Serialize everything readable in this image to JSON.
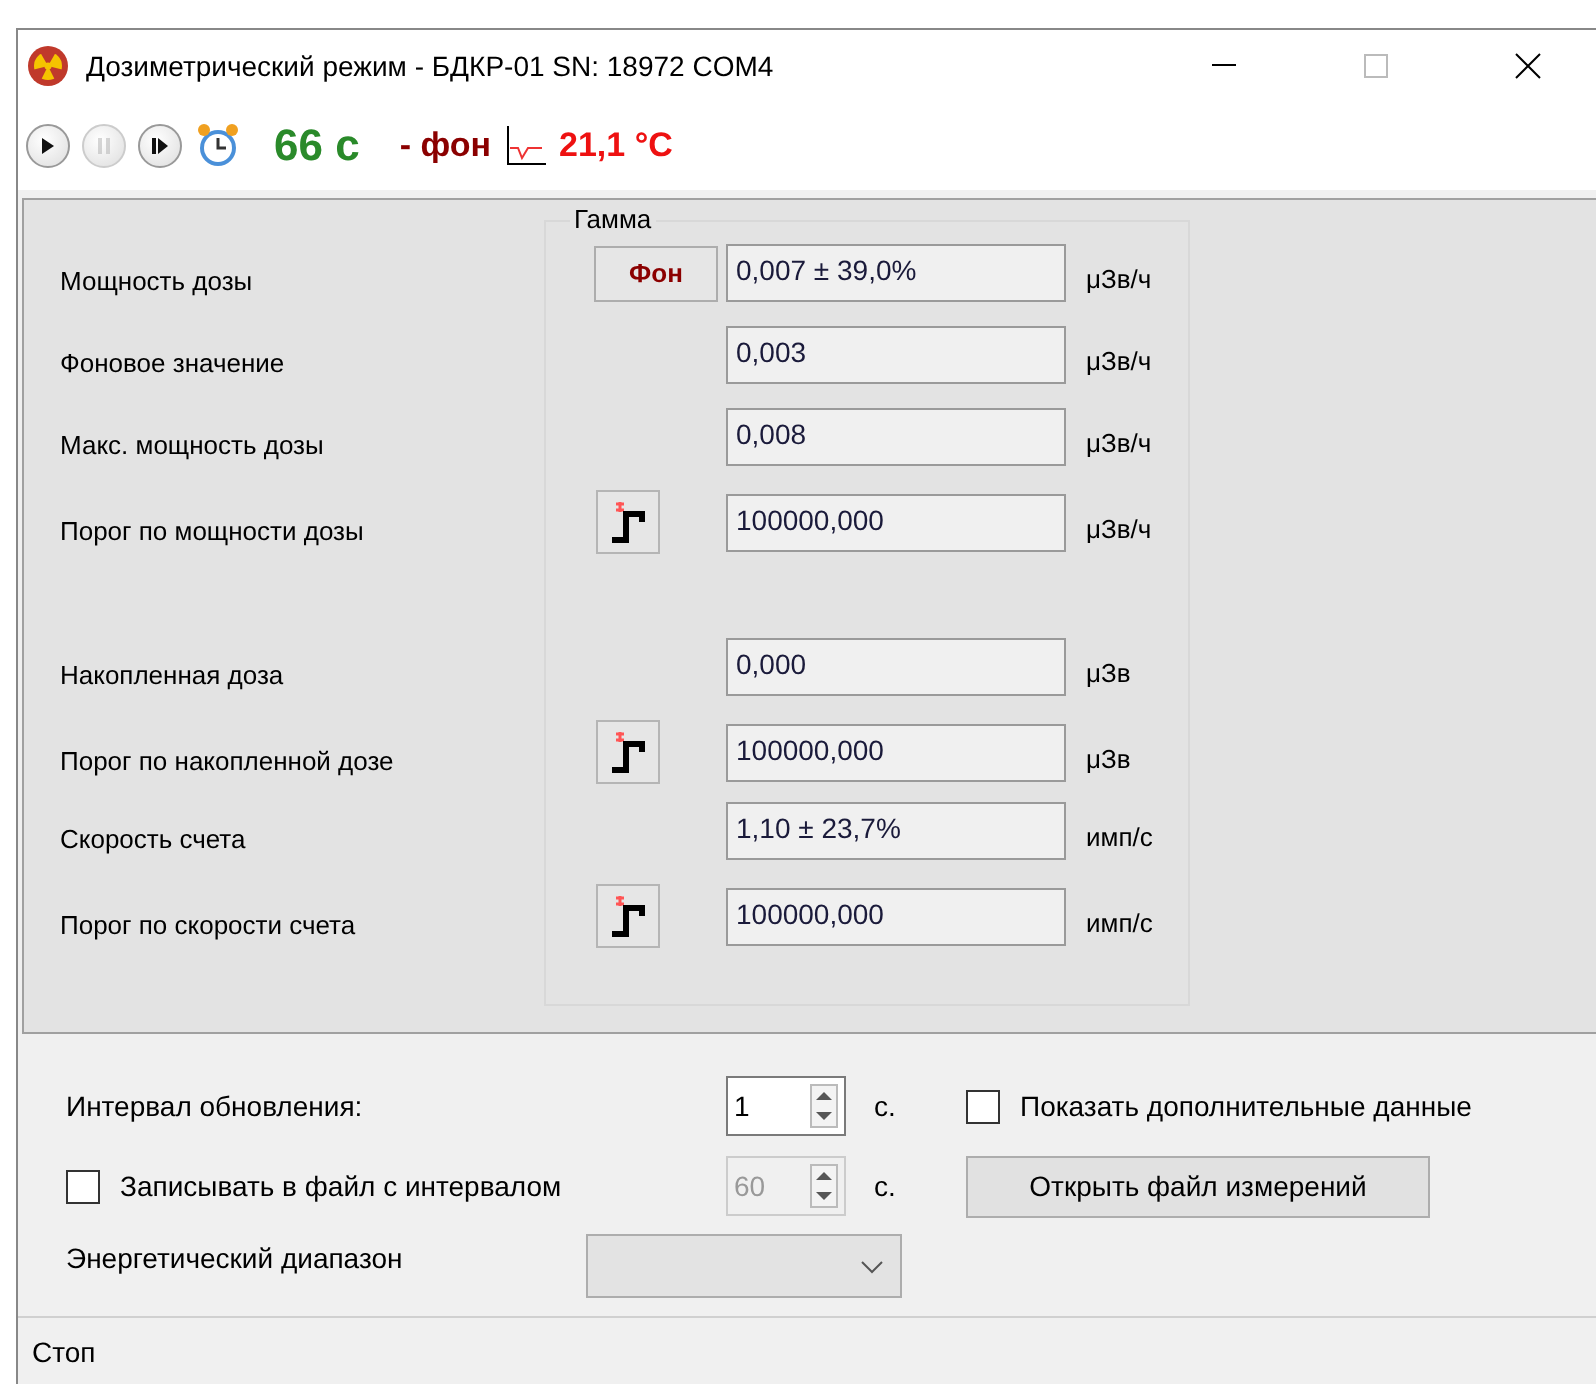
{
  "window": {
    "title": "Дозиметрический режим - БДКР-01 SN: 18972 COM4"
  },
  "toolbar": {
    "buttons": [
      {
        "kind": "play",
        "disabled": false
      },
      {
        "kind": "pause",
        "disabled": true
      },
      {
        "kind": "step",
        "disabled": false
      }
    ],
    "timer": "66 с",
    "mode": "- фон",
    "temperature": "21,1 °C"
  },
  "group": {
    "title": "Гамма",
    "sections": [
      [
        {
          "label": "Мощность дозы",
          "button": {
            "kind": "text",
            "label": "Фон"
          },
          "value": "0,007 ± 39,0%",
          "unit": "μЗв/ч"
        },
        {
          "label": "Фоновое значение",
          "value": "0,003",
          "unit": "μЗв/ч"
        },
        {
          "label": "Макс. мощность дозы",
          "value": "0,008",
          "unit": "μЗв/ч"
        },
        {
          "label": "Порог по мощности дозы",
          "button": {
            "kind": "threshold"
          },
          "value": "100000,000",
          "unit": "μЗв/ч"
        }
      ],
      [
        {
          "label": "Накопленная доза",
          "value": "0,000",
          "unit": "μЗв"
        },
        {
          "label": "Порог по накопленной дозе",
          "button": {
            "kind": "threshold"
          },
          "value": "100000,000",
          "unit": "μЗв"
        },
        {
          "label": "Скорость счета",
          "value": "1,10 ± 23,7%",
          "unit": "имп/с"
        },
        {
          "label": "Порог по скорости счета",
          "button": {
            "kind": "threshold"
          },
          "value": "100000,000",
          "unit": "имп/с"
        }
      ]
    ]
  },
  "settings": {
    "update_interval": {
      "label": "Интервал обновления:",
      "value": "1",
      "unit": "с."
    },
    "show_extra": {
      "label": "Показать дополнительные данные",
      "checked": false
    },
    "write_to_file": {
      "label": "Записывать в файл с интервалом",
      "checked": false,
      "value": "60",
      "unit": "с.",
      "disabled": true
    },
    "open_file_button": "Открыть файл измерений",
    "energy_range": {
      "label": "Энергетический диапазон",
      "disabled": true
    }
  },
  "status_bar": "Стоп"
}
